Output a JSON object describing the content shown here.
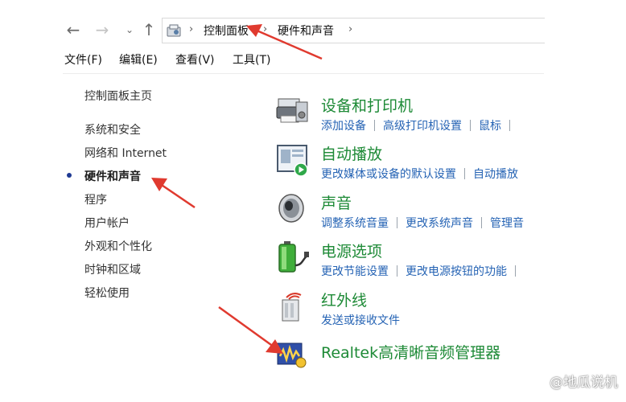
{
  "nav": {
    "back_icon": "←",
    "forward_icon": "→",
    "recent_icon": "⌄",
    "up_icon": "↑",
    "breadcrumb": [
      "控制面板",
      "硬件和声音"
    ],
    "crumb_sep": "›"
  },
  "menu": [
    "文件(F)",
    "编辑(E)",
    "查看(V)",
    "工具(T)"
  ],
  "sidebar": {
    "home": "控制面板主页",
    "items": [
      "系统和安全",
      "网络和 Internet",
      "硬件和声音",
      "程序",
      "用户帐户",
      "外观和个性化",
      "时钟和区域",
      "轻松使用"
    ],
    "active_index": 2
  },
  "categories": [
    {
      "title": "设备和打印机",
      "icon": "printer-icon",
      "links": [
        "添加设备",
        "高级打印机设置",
        "鼠标"
      ]
    },
    {
      "title": "自动播放",
      "icon": "autoplay-icon",
      "links": [
        "更改媒体或设备的默认设置",
        "自动播放"
      ]
    },
    {
      "title": "声音",
      "icon": "speaker-icon",
      "links": [
        "调整系统音量",
        "更改系统声音",
        "管理音"
      ]
    },
    {
      "title": "电源选项",
      "icon": "battery-icon",
      "links": [
        "更改节能设置",
        "更改电源按钮的功能"
      ]
    },
    {
      "title": "红外线",
      "icon": "infrared-icon",
      "links": [
        "发送或接收文件"
      ]
    },
    {
      "title": "Realtek高清晰音频管理器",
      "icon": "realtek-audio-icon",
      "links": []
    }
  ],
  "watermark": "@地瓜说机",
  "colors": {
    "category_title": "#1d8a36",
    "link": "#2563b4",
    "annotation_arrow": "#e03a2f"
  }
}
